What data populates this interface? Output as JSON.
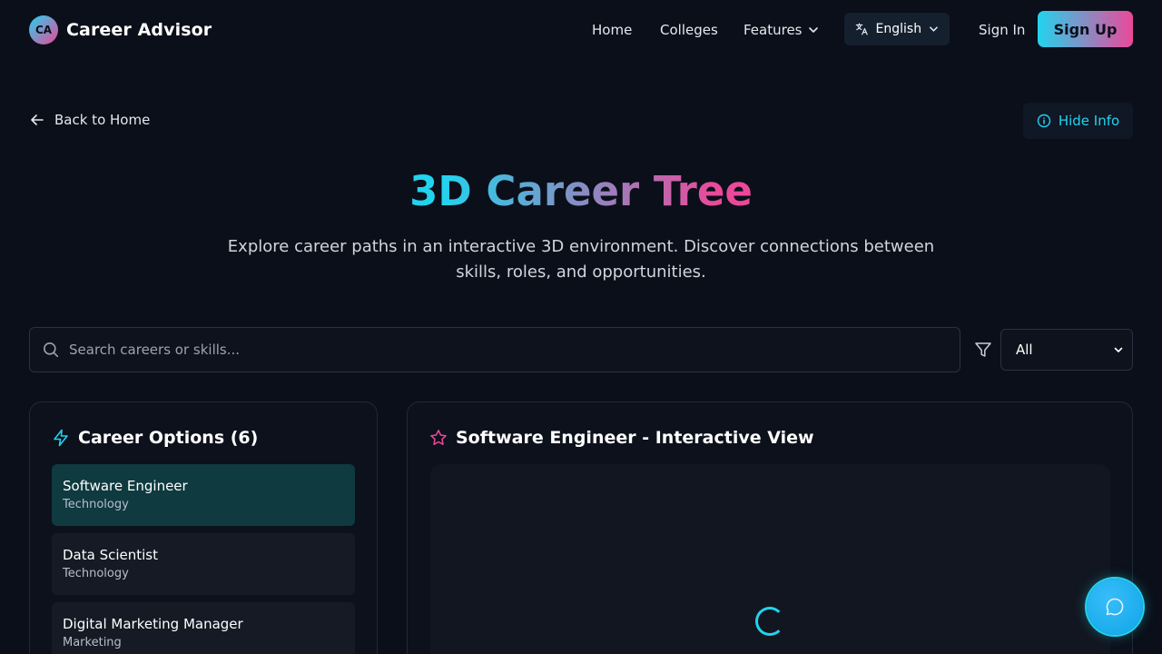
{
  "brand": {
    "logo_text": "CA",
    "name": "Career Advisor"
  },
  "nav": {
    "home": "Home",
    "colleges": "Colleges",
    "features": "Features",
    "language": "English",
    "sign_in": "Sign In",
    "sign_up": "Sign Up"
  },
  "toolbar": {
    "back": "Back to Home",
    "hide_info": "Hide Info"
  },
  "hero": {
    "title": "3D Career Tree",
    "subtitle": "Explore career paths in an interactive 3D environment. Discover connections between skills, roles, and opportunities."
  },
  "search": {
    "placeholder": "Search careers or skills...",
    "value": ""
  },
  "filter": {
    "selected": "All"
  },
  "careers": {
    "heading": "Career Options (6)",
    "items": [
      {
        "title": "Software Engineer",
        "category": "Technology",
        "active": true
      },
      {
        "title": "Data Scientist",
        "category": "Technology",
        "active": false
      },
      {
        "title": "Digital Marketing Manager",
        "category": "Marketing",
        "active": false
      }
    ]
  },
  "viewer": {
    "heading": "Software Engineer - Interactive View"
  },
  "colors": {
    "accent_cyan": "#22d3ee",
    "accent_pink": "#ec4899",
    "background": "#0b0f19"
  },
  "icons": [
    "translate-icon",
    "chevron-down-icon",
    "arrow-left-icon",
    "info-icon",
    "search-icon",
    "filter-icon",
    "zap-icon",
    "star-icon",
    "chat-icon",
    "loading-spinner"
  ]
}
